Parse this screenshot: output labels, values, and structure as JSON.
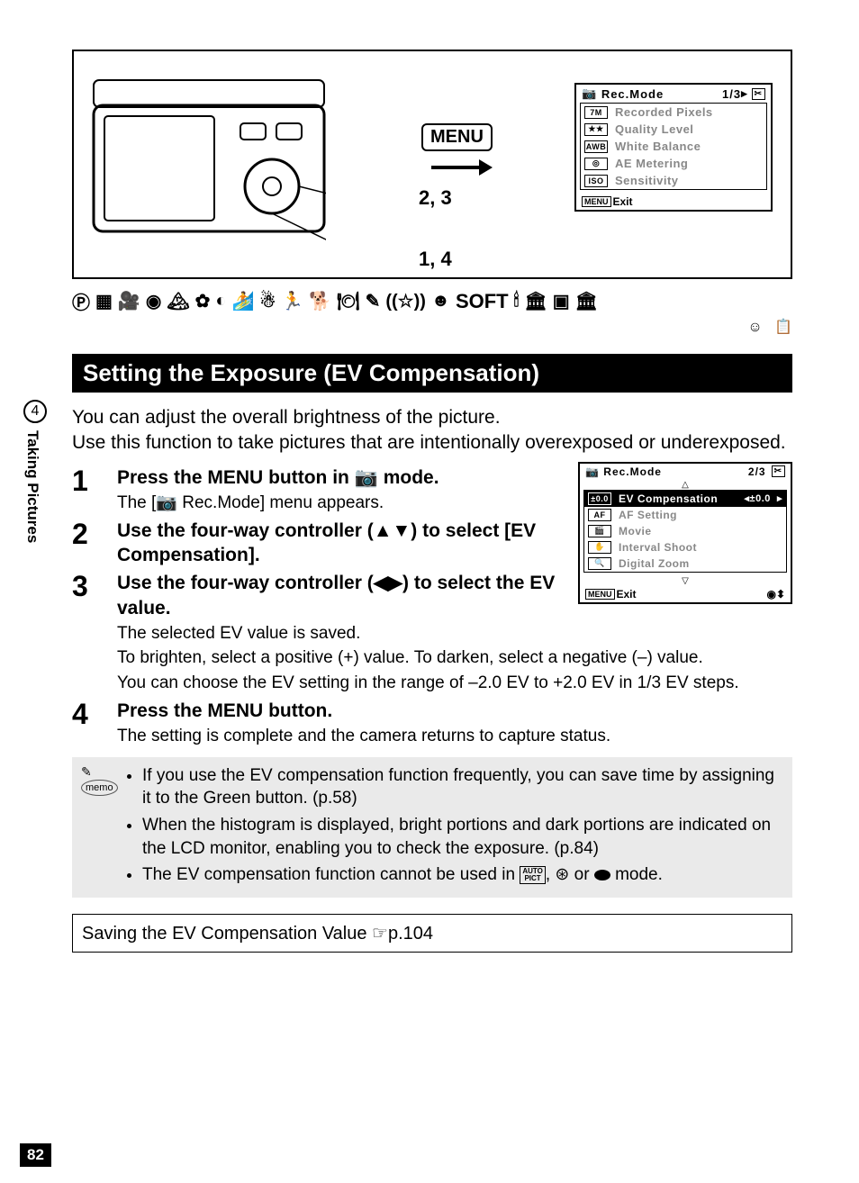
{
  "side": {
    "chapter_num": "4",
    "chapter_title": "Taking Pictures"
  },
  "page_number": "82",
  "top_diagram": {
    "menu_label": "MENU",
    "pointer_23": "2, 3",
    "pointer_14": "1, 4"
  },
  "lcd1": {
    "title": "Rec.Mode",
    "page": "1/3",
    "items": [
      {
        "icon": "7M",
        "label": "Recorded Pixels"
      },
      {
        "icon": "★★",
        "label": "Quality Level"
      },
      {
        "icon": "AWB",
        "label": "White Balance"
      },
      {
        "icon": "◎",
        "label": "AE Metering"
      },
      {
        "icon": "ISO",
        "label": "Sensitivity"
      }
    ],
    "footer_menu": "MENU",
    "footer_text": "Exit"
  },
  "soft_label": "SOFT",
  "section_title": "Setting the Exposure (EV Compensation)",
  "intro_1": "You can adjust the overall brightness of the picture.",
  "intro_2": "Use this function to take pictures that are intentionally overexposed or underexposed.",
  "steps": {
    "s1": {
      "title_a": "Press the ",
      "title_menu": "MENU",
      "title_b": " button in ",
      "title_c": " mode.",
      "desc_a": "The [",
      "desc_b": " Rec.Mode] menu appears."
    },
    "s2": {
      "title": "Use the four-way controller (▲▼) to select [EV Compensation]."
    },
    "s3": {
      "title": "Use the four-way controller (◀▶) to select the EV value.",
      "desc_1": "The selected EV value is saved.",
      "desc_2": "To brighten, select a positive (+) value. To darken, select a negative (–) value.",
      "desc_3": "You can choose the EV setting in the range of –2.0 EV to +2.0 EV in 1/3 EV steps."
    },
    "s4": {
      "title_a": "Press the ",
      "title_menu": "MENU",
      "title_b": " button.",
      "desc": "The setting is complete and the camera returns to capture status."
    }
  },
  "lcd2": {
    "title": "Rec.Mode",
    "page": "2/3",
    "items": [
      {
        "icon": "±0.0",
        "label": "EV Compensation",
        "value": "±0.0",
        "active": true
      },
      {
        "icon": "AF",
        "label": "AF Setting"
      },
      {
        "icon": "🎬",
        "label": "Movie"
      },
      {
        "icon": "✋",
        "label": "Interval Shoot"
      },
      {
        "icon": "🔍",
        "label": "Digital Zoom"
      }
    ],
    "footer_menu": "MENU",
    "footer_text": "Exit"
  },
  "memo_label": "memo",
  "memo": {
    "item1": "If you use the EV compensation function frequently, you can save time by assigning it to the Green button. (p.58)",
    "item2": "When the histogram is displayed, bright portions and dark portions are indicated on the LCD monitor, enabling you to check the exposure. (p.84)",
    "item3_a": "The EV compensation function cannot be used in ",
    "item3_auto": "AUTO PICT",
    "item3_b": ", ",
    "item3_c": " or ",
    "item3_d": " mode."
  },
  "ref_box": "Saving the EV Compensation Value ☞p.104"
}
